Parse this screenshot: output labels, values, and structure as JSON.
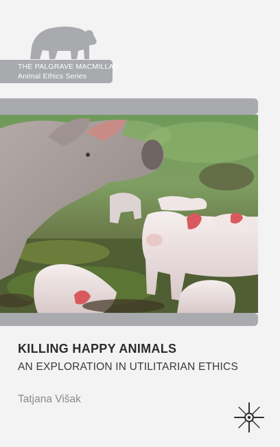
{
  "series": {
    "line1": "THE PALGRAVE MACMILLAN",
    "line2": "Animal Ethics Series",
    "logo_icon": "bear-icon"
  },
  "book": {
    "title": "KILLING HAPPY ANIMALS",
    "subtitle": "AN EXPLORATION IN UTILITARIAN ETHICS",
    "author": "Tatjana Višak"
  },
  "publisher": {
    "logo_icon": "palgrave-star-icon"
  },
  "colors": {
    "background": "#f3f3f4",
    "band_gray": "#a8aaad",
    "title_text": "#2b2b2b",
    "author_text": "#8a8a8a"
  }
}
